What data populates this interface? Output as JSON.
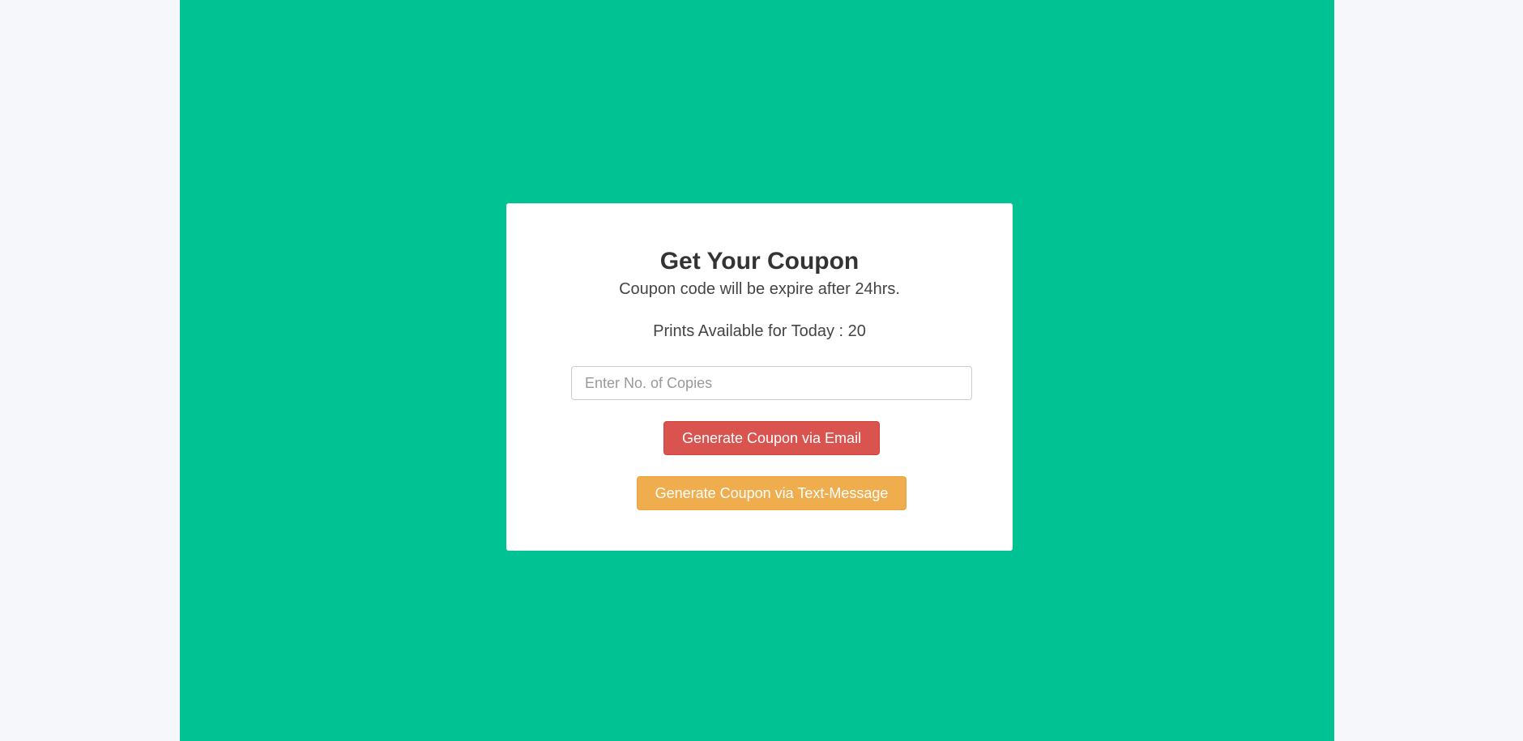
{
  "coupon_form": {
    "title": "Get Your Coupon",
    "subtitle": "Coupon code will be expire after 24hrs.",
    "prints_available": "Prints Available for Today : 20",
    "copies_input": {
      "value": "",
      "placeholder": "Enter No. of Copies"
    },
    "email_button_label": "Generate Coupon via Email",
    "sms_button_label": "Generate Coupon via Text-Message"
  },
  "colors": {
    "page_background": "#f6f7fa",
    "stage_background": "#00c292",
    "card_background": "#ffffff",
    "email_button": "#d9534f",
    "sms_button": "#f0ad4e"
  }
}
